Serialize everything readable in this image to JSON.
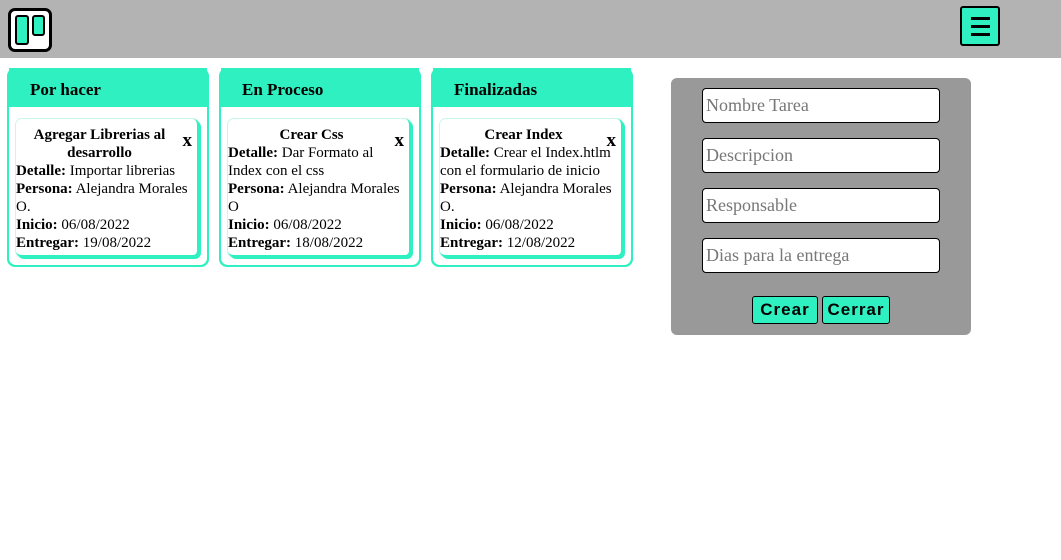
{
  "header": {
    "logo_icon": "trello-board-icon",
    "menu_icon": "hamburger-menu-icon"
  },
  "columns": [
    {
      "title": "Por hacer",
      "cards": [
        {
          "title": "Agregar Librerias al desarrollo",
          "close": "x",
          "detail_label": "Detalle:",
          "detail": "Importar librerias",
          "person_label": "Persona:",
          "person": "Alejandra Morales O.",
          "start_label": "Inicio:",
          "start": "06/08/2022",
          "due_label": "Entregar:",
          "due": "19/08/2022"
        }
      ]
    },
    {
      "title": "En Proceso",
      "cards": [
        {
          "title": "Crear Css",
          "close": "x",
          "detail_label": "Detalle:",
          "detail": "Dar Formato al Index con el css",
          "person_label": "Persona:",
          "person": "Alejandra Morales O",
          "start_label": "Inicio:",
          "start": "06/08/2022",
          "due_label": "Entregar:",
          "due": "18/08/2022"
        }
      ]
    },
    {
      "title": "Finalizadas",
      "cards": [
        {
          "title": "Crear Index",
          "close": "x",
          "detail_label": "Detalle:",
          "detail": "Crear el Index.htlm con el formulario de inicio",
          "person_label": "Persona:",
          "person": "Alejandra Morales O.",
          "start_label": "Inicio:",
          "start": "06/08/2022",
          "due_label": "Entregar:",
          "due": "12/08/2022"
        }
      ]
    }
  ],
  "form": {
    "task_name_placeholder": "Nombre Tarea",
    "description_placeholder": "Descripcion",
    "responsible_placeholder": "Responsable",
    "days_placeholder": "Dias para la entrega",
    "create_label": "Crear",
    "close_label": "Cerrar"
  },
  "colors": {
    "accent": "#2ff0c0",
    "header_bg": "#b3b3b3",
    "panel_bg": "#999999"
  }
}
